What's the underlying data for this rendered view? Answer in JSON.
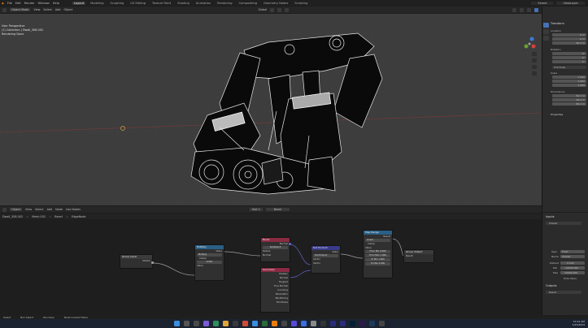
{
  "menubar": {
    "items": [
      "File",
      "Edit",
      "Render",
      "Window",
      "Help"
    ],
    "workspace_tabs": [
      "Layout",
      "Modeling",
      "Sculpting",
      "UV Editing",
      "Texture Paint",
      "Shading",
      "Animation",
      "Rendering",
      "Compositing",
      "Geometry Nodes",
      "Scripting"
    ],
    "active_tab": "Layout",
    "scene_label": "Scene",
    "view_layer_label": "ViewLayer"
  },
  "viewport_header": {
    "mode": "Object Mode",
    "menus": [
      "View",
      "Select",
      "Add",
      "Object"
    ],
    "transform_orientation": "Global"
  },
  "viewport": {
    "info_line1": "User Perspective",
    "info_line2": "(1) Collection | Dwall_308.002",
    "info_line3": "Rendering Done",
    "model_name": "Dwall_308.002"
  },
  "properties": {
    "tab_label": "Transform",
    "location_label": "Location",
    "location": {
      "x": "0 m",
      "y": "0 m",
      "z": "80.3 m"
    },
    "rotation_label": "Rotation",
    "rotation": {
      "x": "0°",
      "y": "0°",
      "z": "0°"
    },
    "rotation_mode": "XYZ Euler",
    "scale_label": "Scale",
    "scale": {
      "x": "1.000",
      "y": "1.000",
      "z": "1.000"
    },
    "dimensions_label": "Dimensions",
    "dimensions": {
      "x": "81.7 m",
      "y": "95.4 m",
      "z": "80.2 m"
    },
    "properties_label": "Properties",
    "item_name": "Dwall_308.002"
  },
  "node_header": {
    "editor": "Object",
    "menus": [
      "View",
      "Select",
      "Add",
      "Node"
    ],
    "use_nodes": "Use Nodes",
    "slot": "Slot 1",
    "material": "Bevel"
  },
  "breadcrumb": [
    "Dwall_308.002",
    "Mesh.002",
    "Bevel",
    "EdgeNode"
  ],
  "nodes": {
    "group_input": {
      "title": "Group Input",
      "out": "Shader"
    },
    "multiply": {
      "title": "Multiply",
      "out": "Value",
      "op": "Multiply",
      "clamp": "Clamp",
      "value_label": "Value",
      "value": "0.020",
      "in": "Value"
    },
    "bevel": {
      "title": "Bevel",
      "samples": "Samples",
      "samples_value": "8",
      "rows": [
        "Radius",
        "Normal"
      ]
    },
    "geometry": {
      "title": "Geometry",
      "rows": [
        "Position",
        "Normal",
        "Tangent",
        "True Normal",
        "Incoming",
        "Parametric",
        "Backfacing",
        "Pointiness"
      ]
    },
    "dot_product": {
      "title": "Dot Product",
      "op": "Dot Product",
      "out": "Value",
      "rows": [
        "Vector",
        "Vector"
      ]
    },
    "map_range": {
      "title": "Map Range",
      "out": "Result",
      "mode": "Linear",
      "clamp": "Clamp",
      "value": "Value",
      "from_min": "From Min",
      "from_min_v": "0.000",
      "from_max": "From Max",
      "from_max_v": "1.000",
      "to_min": "To Min",
      "to_min_v": "1.000",
      "to_max": "To Max",
      "to_max_v": "0.000"
    },
    "group_output": {
      "title": "Group Output",
      "in": "Result"
    }
  },
  "node_sidebar": {
    "section": "Inputs",
    "item": "Shader",
    "type_label": "Type",
    "type_value": "Float",
    "name_label": "Name",
    "name_value": "Shader",
    "default_label": "Default",
    "default_value": "0.100",
    "min_label": "Min",
    "min_value": "-10000.000",
    "max_label": "Max",
    "max_value": "10000.000",
    "hide_label": "Hide Value",
    "outputs_section": "Outputs",
    "output_item": "Result"
  },
  "statusbar": {
    "select": "Select",
    "box_select": "Box Select",
    "pan": "Pan View",
    "context": "Node Context Menu"
  },
  "taskbar": {
    "time": "10:12 AM",
    "date": "1/23/2024"
  },
  "colors": {
    "header_geometry": "#2f7a8a",
    "header_converter": "#2a5f86",
    "header_input": "#8a2a43",
    "header_vector": "#3a3a8a"
  }
}
